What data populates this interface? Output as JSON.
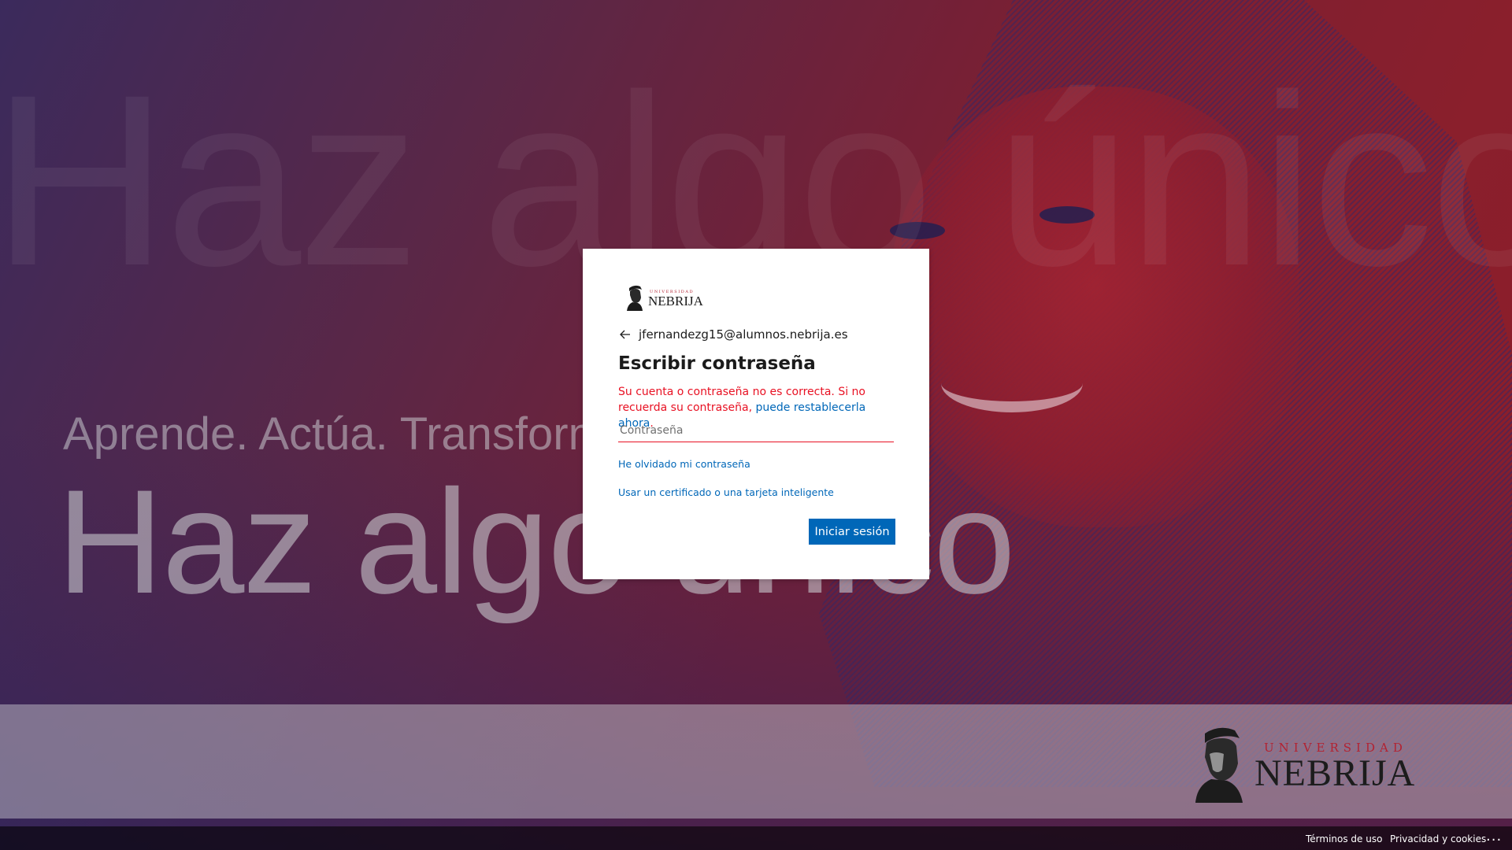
{
  "background": {
    "ghost_text": "Haz algo único",
    "tagline": "Aprende. Actúa. Transforma.",
    "headline": "Haz algo único"
  },
  "brand": {
    "university_label": "UNIVERSIDAD",
    "name": "NEBRIJA"
  },
  "signin": {
    "logo_univ": "UNIVERSIDAD",
    "logo_name": "NEBRIJA",
    "back_icon": "arrow-left-icon",
    "email": "jfernandezg15@alumnos.nebrija.es",
    "title": "Escribir contraseña",
    "error_text": "Su cuenta o contraseña no es correcta. Si no recuerda su contraseña, ",
    "error_link": "puede restablecerla ahora",
    "error_suffix": ".",
    "password_placeholder": "Contraseña",
    "password_value": "",
    "forgot_link": "He olvidado mi contraseña",
    "cert_link": "Usar un certificado o una tarjeta inteligente",
    "submit_label": "Iniciar sesión"
  },
  "footer": {
    "terms": "Términos de uso",
    "privacy": "Privacidad y cookies",
    "more": "..."
  },
  "colors": {
    "accent": "#0067b8",
    "error": "#e81123",
    "brand_red": "#b22232"
  }
}
